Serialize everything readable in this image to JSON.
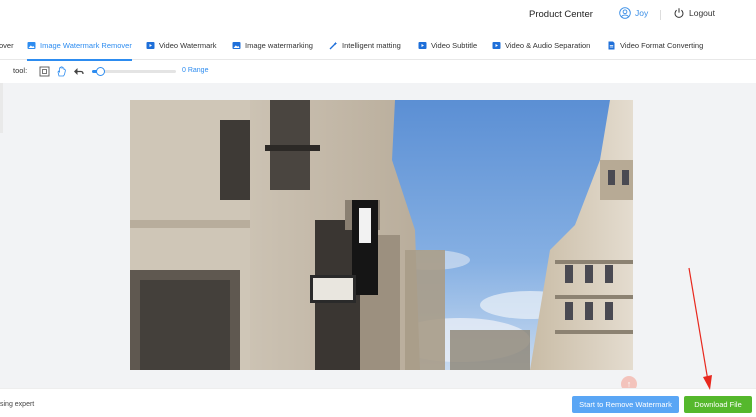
{
  "header": {
    "product_center": "Product Center",
    "user_name": "Joy",
    "logout": "Logout"
  },
  "tabs": [
    {
      "label": "over",
      "icon": "image-icon"
    },
    {
      "label": "Image Watermark Remover",
      "icon": "image-icon",
      "active": true
    },
    {
      "label": "Video Watermark",
      "icon": "video-icon"
    },
    {
      "label": "Image watermarking",
      "icon": "image-icon"
    },
    {
      "label": "Intelligent matting",
      "icon": "wand-icon"
    },
    {
      "label": "Video Subtitle",
      "icon": "video-icon"
    },
    {
      "label": "Video & Audio Separation",
      "icon": "video-icon"
    },
    {
      "label": "Video Format Converting",
      "icon": "file-icon"
    }
  ],
  "toolbar": {
    "label": "tool:",
    "range_label": "0 Range",
    "range_value": 0.1
  },
  "footer": {
    "status_text": "sing expert",
    "remove_button": "Start to Remove Watermark",
    "download_button": "Download File"
  },
  "colors": {
    "accent": "#2d8cf0",
    "remove_button": "#5aa6f5",
    "download_button": "#55b82c",
    "annotation_arrow": "#e8281e"
  }
}
